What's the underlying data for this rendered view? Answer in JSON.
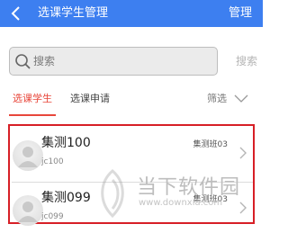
{
  "header": {
    "title": "选课学生管理",
    "action": "管理"
  },
  "search": {
    "placeholder": "搜索",
    "button": "搜索"
  },
  "tabs": [
    {
      "label": "选课学生",
      "active": true
    },
    {
      "label": "选课申请",
      "active": false
    }
  ],
  "filter": {
    "label": "筛选"
  },
  "students": [
    {
      "name": "集测100",
      "id": "jc100",
      "class": "集测班03"
    },
    {
      "name": "集测099",
      "id": "jc099",
      "class": "集测班03"
    }
  ],
  "watermark": {
    "text": "当下软件园",
    "url": "www.downxia.com"
  },
  "colors": {
    "header": "#3d7ff0",
    "accent": "#e8473b",
    "highlight_border": "#d71f26"
  }
}
